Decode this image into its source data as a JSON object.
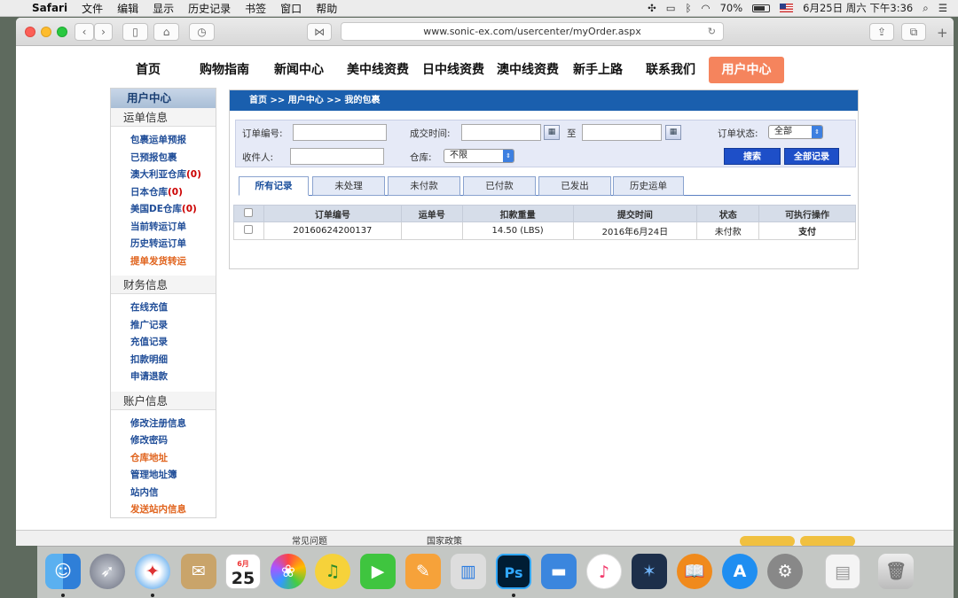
{
  "menubar": {
    "app": "Safari",
    "items": [
      "文件",
      "编辑",
      "显示",
      "历史记录",
      "书签",
      "窗口",
      "帮助"
    ],
    "battery": "70%",
    "datetime": "6月25日 周六 下午3:36"
  },
  "browser": {
    "url": "www.sonic-ex.com/usercenter/myOrder.aspx"
  },
  "nav": {
    "items": [
      "首页",
      "购物指南",
      "新闻中心",
      "美中线资费",
      "日中线资费",
      "澳中线资费",
      "新手上路",
      "联系我们",
      "用户中心"
    ]
  },
  "sidebar": {
    "title": "用户中心",
    "sections": [
      {
        "title": "运单信息",
        "links": [
          {
            "label": "包裹运单预报"
          },
          {
            "label": "已预报包裹"
          },
          {
            "label": "澳大利亚仓库",
            "count": "(0)"
          },
          {
            "label": "日本仓库",
            "count": "(0)"
          },
          {
            "label": "美国DE仓库",
            "count": "(0)"
          },
          {
            "label": "当前转运订单"
          },
          {
            "label": "历史转运订单"
          },
          {
            "label": "提单发货转运"
          }
        ]
      },
      {
        "title": "财务信息",
        "links": [
          {
            "label": "在线充值"
          },
          {
            "label": "推广记录"
          },
          {
            "label": "充值记录"
          },
          {
            "label": "扣款明细"
          },
          {
            "label": "申请退款"
          }
        ]
      },
      {
        "title": "账户信息",
        "links": [
          {
            "label": "修改注册信息"
          },
          {
            "label": "修改密码"
          },
          {
            "label": "仓库地址"
          },
          {
            "label": "管理地址簿"
          },
          {
            "label": "站内信"
          },
          {
            "label": "发送站内信息"
          }
        ]
      }
    ]
  },
  "main": {
    "breadcrumb": "首页 >> 用户中心 >> 我的包裹",
    "filter": {
      "order_no_label": "订单编号:",
      "deal_time_label": "成交时间:",
      "to_label": "至",
      "status_label": "订单状态:",
      "status_value": "全部",
      "recipient_label": "收件人:",
      "warehouse_label": "仓库:",
      "warehouse_value": "不限",
      "search_button": "搜索",
      "all_button": "全部记录"
    },
    "tabs": [
      "所有记录",
      "未处理",
      "未付款",
      "已付款",
      "已发出",
      "历史运单"
    ],
    "table": {
      "headers": [
        "订单编号",
        "运单号",
        "扣款重量",
        "提交时间",
        "状态",
        "可执行操作"
      ],
      "rows": [
        [
          "20160624200137",
          "",
          "14.50 (LBS)",
          "2016年6月24日",
          "未付款",
          "支付"
        ]
      ]
    }
  },
  "footer": {
    "links": [
      "常见问题",
      "国家政策"
    ]
  },
  "dock": {
    "calendar_month": "6月",
    "calendar_day": "25"
  }
}
